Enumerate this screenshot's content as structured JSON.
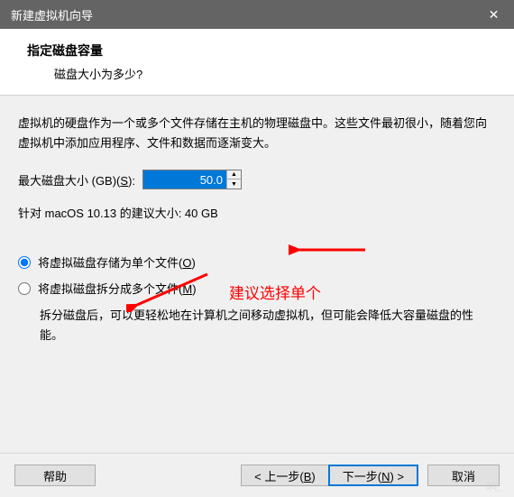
{
  "window": {
    "title": "新建虚拟机向导",
    "close": "✕"
  },
  "header": {
    "title": "指定磁盘容量",
    "subtitle": "磁盘大小为多少?"
  },
  "body": {
    "description": "虚拟机的硬盘作为一个或多个文件存储在主机的物理磁盘中。这些文件最初很小，随着您向虚拟机中添加应用程序、文件和数据而逐渐变大。",
    "size_label_pre": "最大磁盘大小 (GB)(",
    "size_hotkey": "S",
    "size_label_post": "):",
    "size_value": "50.0",
    "suggestion": "针对 macOS 10.13 的建议大小: 40 GB",
    "radios": [
      {
        "pre": "将虚拟磁盘存储为单个文件(",
        "hk": "O",
        "post": ")",
        "checked": true
      },
      {
        "pre": "将虚拟磁盘拆分成多个文件(",
        "hk": "M",
        "post": ")",
        "checked": false
      }
    ],
    "split_desc": "拆分磁盘后，可以更轻松地在计算机之间移动虚拟机，但可能会降低大容量磁盘的性能。",
    "annotation": "建议选择单个"
  },
  "buttons": {
    "help": "帮助",
    "back_pre": "< 上一步(",
    "back_hk": "B",
    "back_post": ")",
    "next_pre": "下一步(",
    "next_hk": "N",
    "next_post": ") >",
    "cancel": "取消"
  },
  "watermark": "qq_"
}
